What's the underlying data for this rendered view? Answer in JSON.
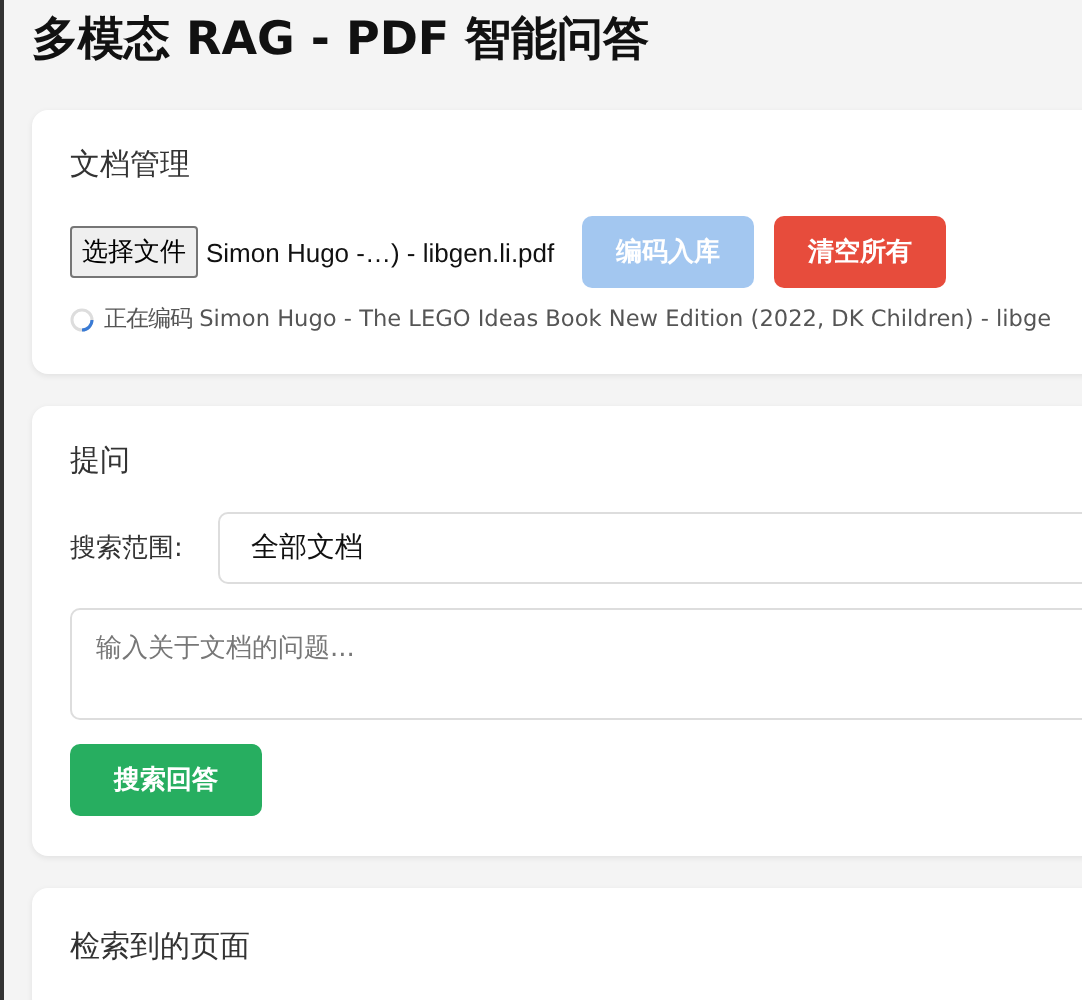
{
  "title": "多模态 RAG - PDF 智能问答",
  "documents": {
    "heading": "文档管理",
    "file_button": "选择文件",
    "file_name": "Simon Hugo -…) - libgen.li.pdf",
    "buttons": [
      {
        "kind": "primary",
        "label": "编码入库",
        "disabled": true
      },
      {
        "kind": "danger",
        "label": "清空所有",
        "disabled": false
      }
    ],
    "status": {
      "loading": true,
      "text": "正在编码 Simon Hugo - The LEGO Ideas Book New Edition (2022, DK Children) - libge"
    }
  },
  "question": {
    "heading": "提问",
    "scope_label": "搜索范围:",
    "scope_value": "全部文档",
    "placeholder": "输入关于文档的问题...",
    "submit": "搜索回答"
  },
  "results": {
    "heading": "检索到的页面"
  }
}
